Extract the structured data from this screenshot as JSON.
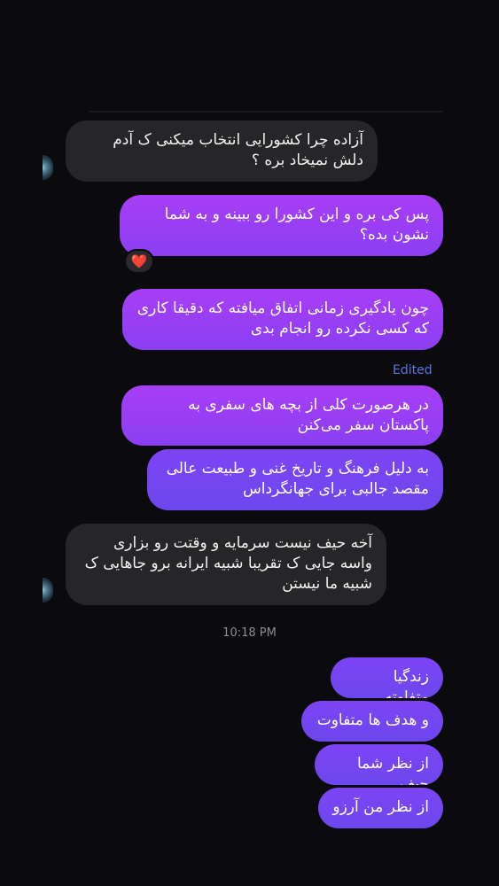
{
  "messages": [
    {
      "text": "آزاده چرا کشورایی انتخاب میکنی ک آدم دلش نمیخاد بره ؟"
    },
    {
      "text": "پس کی بره و این کشورا رو ببینه و به شما نشون بده؟",
      "reaction": "❤️"
    },
    {
      "text": "چون یادگیری زمانی اتفاق میافته که دقیقا کاری که کسی نکرده رو انجام بدی"
    },
    {
      "text": "در هرصورت کلی از بچه های سفری به پاکستان سفر می‌کنن"
    },
    {
      "text": "به دلیل فرهنگ و تاریخ غنی و طبیعت عالی مقصد جالبی برای جهانگرداس"
    },
    {
      "text": "آخه حیف نیست سرمایه و وقتت رو بزاری واسه جایی ک تقریبا شبیه ایرانه برو جاهایی ک شبیه ما نیستن"
    },
    {
      "text": "زندگیا متفاوته"
    },
    {
      "text": "و هدف ها متفاوت"
    },
    {
      "text": "از نظر شما حیف"
    },
    {
      "text": "از نظر من آرزو"
    }
  ],
  "edited_label": "Edited",
  "timestamp": "10:18 PM",
  "colors": {
    "background": "#0b0b0d",
    "incoming": "#262629",
    "outgoing_purple": "#a83ef6",
    "outgoing_violet": "#6c47ee",
    "edited": "#5b74e6"
  }
}
